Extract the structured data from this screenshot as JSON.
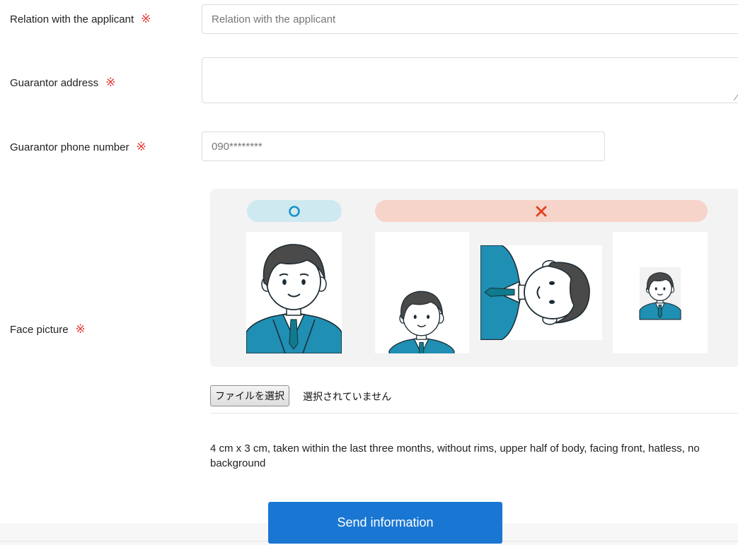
{
  "required_mark": "※",
  "fields": {
    "relation": {
      "label": "Relation with the applicant",
      "placeholder": "Relation with the applicant",
      "value": ""
    },
    "address": {
      "label": "Guarantor address",
      "value": ""
    },
    "phone": {
      "label": "Guarantor phone number",
      "placeholder": "090********",
      "value": ""
    },
    "face": {
      "label": "Face picture"
    }
  },
  "guide": {
    "ok_symbol": "○",
    "ng_symbol": "✕",
    "colors": {
      "ok_pill": "#cfe9f1",
      "ng_pill": "#f6d4ca",
      "ok_mark": "#1a93c8",
      "ng_mark": "#e2401e",
      "suit": "#1f8fb3"
    }
  },
  "file": {
    "button_label": "ファイルを選択",
    "status": "選択されていません"
  },
  "note": "4 cm x 3 cm, taken within the last three months, without rims, upper half of body, facing front, hatless, no background",
  "submit_label": "Send information",
  "colors": {
    "required": "#e53935",
    "primary": "#1976d2"
  }
}
